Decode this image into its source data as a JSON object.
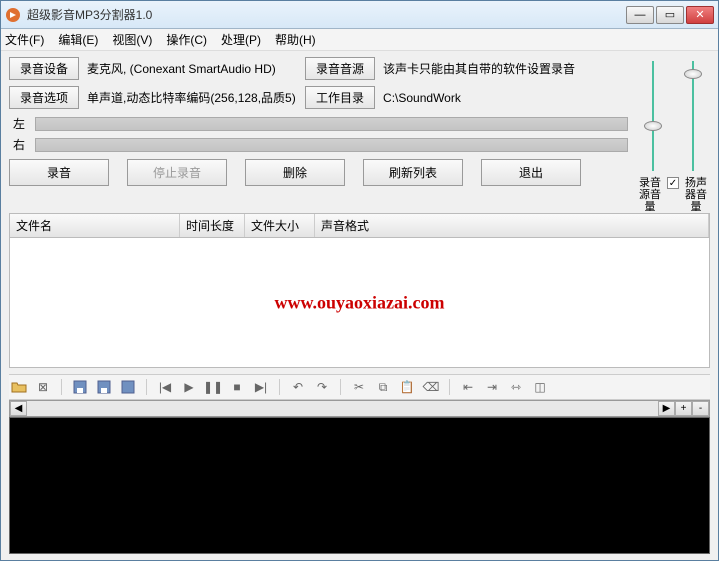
{
  "window": {
    "title": "超级影音MP3分割器1.0"
  },
  "menu": {
    "file": "文件(F)",
    "edit": "编辑(E)",
    "view": "视图(V)",
    "operate": "操作(C)",
    "process": "处理(P)",
    "help": "帮助(H)"
  },
  "buttons": {
    "rec_device": "录音设备",
    "rec_source": "录音音源",
    "rec_options": "录音选项",
    "work_dir": "工作目录",
    "record": "录音",
    "stop_record": "停止录音",
    "delete": "删除",
    "refresh": "刷新列表",
    "exit": "退出"
  },
  "values": {
    "device": "麦克风, (Conexant SmartAudio HD)",
    "source_note": "该声卡只能由其自带的软件设置录音",
    "options": "单声道,动态比特率编码(256,128,品质5)",
    "workdir": "C:\\SoundWork"
  },
  "channels": {
    "left": "左",
    "right": "右"
  },
  "slider_labels": {
    "rec_vol": "录音源音量",
    "spk_vol": "扬声器音量"
  },
  "list_headers": {
    "filename": "文件名",
    "duration": "时间长度",
    "filesize": "文件大小",
    "format": "声音格式"
  },
  "watermark": "www.ouyaoxiazai.com",
  "scroll": {
    "plus": "+",
    "minus": "-"
  }
}
